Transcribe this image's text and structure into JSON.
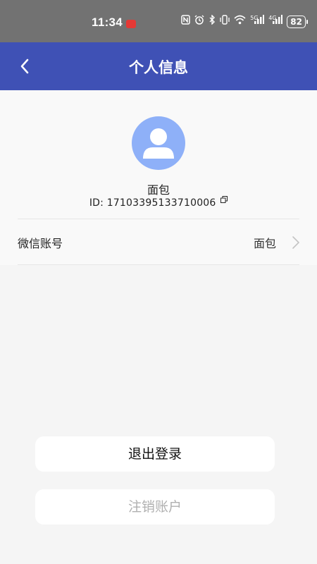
{
  "status_bar": {
    "time": "11:34",
    "icons": [
      "nfc-icon",
      "alarm-icon",
      "bluetooth-icon",
      "vibrate-icon",
      "wifi-icon",
      "signal-5g-icon",
      "signal-4g-icon"
    ],
    "net1": "5G",
    "net2": "4G",
    "battery": "82"
  },
  "app_bar": {
    "title": "个人信息",
    "color": "#3f51b5"
  },
  "profile": {
    "name": "面包",
    "id_label": "ID:",
    "id_value": "17103395133710006"
  },
  "rows": [
    {
      "label": "微信账号",
      "value": "面包"
    }
  ],
  "buttons": {
    "logout": "退出登录",
    "cancel_account": "注销账户"
  }
}
